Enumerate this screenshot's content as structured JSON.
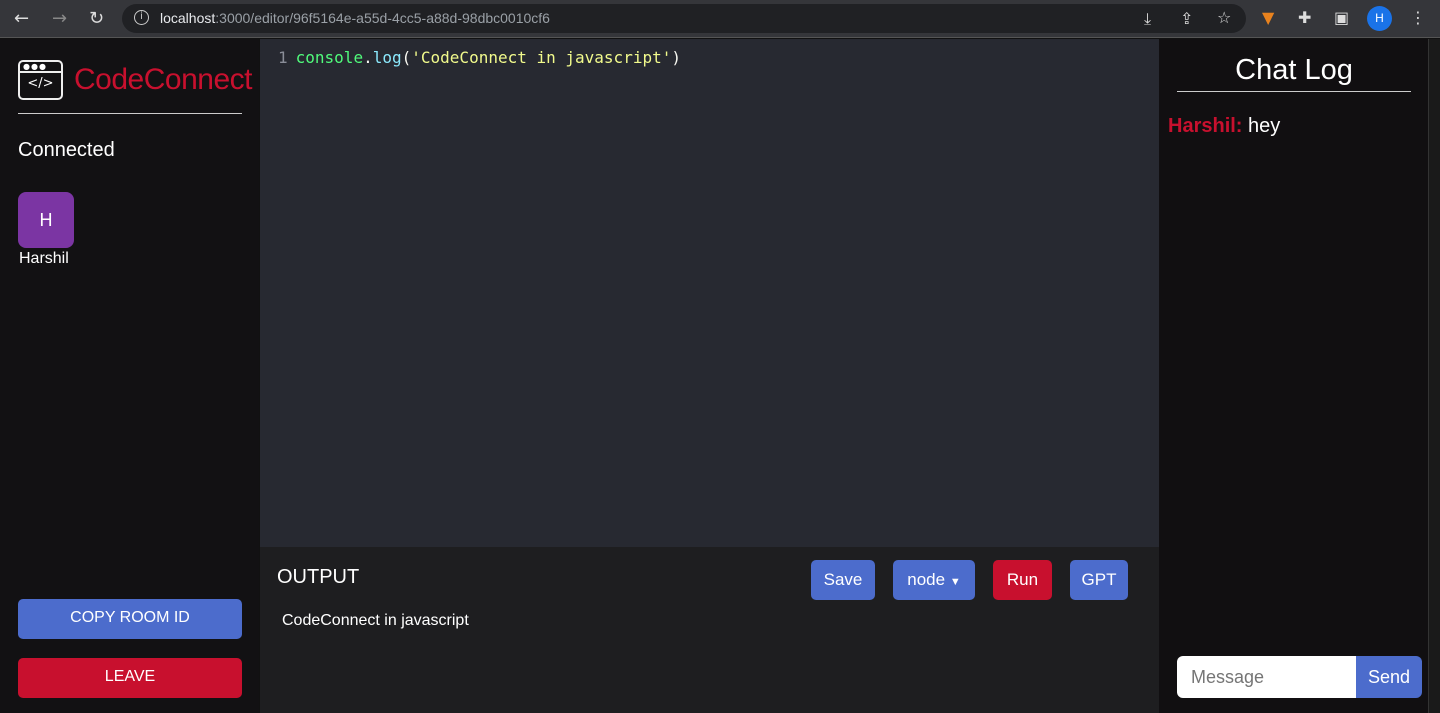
{
  "browser": {
    "url_host": "localhost",
    "url_rest": ":3000/editor/96f5164e-a55d-4cc5-a88d-98dbc0010cf6",
    "profile_initial": "H"
  },
  "sidebar": {
    "brand": "CodeConnect",
    "logo_glyph": "</>",
    "connected_label": "Connected",
    "users": [
      {
        "initial": "H",
        "name": "Harshil",
        "color": "#7b35a3"
      }
    ],
    "copy_room_label": "COPY ROOM ID",
    "leave_label": "LEAVE"
  },
  "editor": {
    "lines": [
      {
        "number": "1",
        "obj": "console",
        "dot": ".",
        "method": "log",
        "open": "(",
        "string": "'CodeConnect in javascript'",
        "close": ")"
      }
    ]
  },
  "output": {
    "title": "OUTPUT",
    "text": "CodeConnect in javascript",
    "save_label": "Save",
    "language": "node",
    "run_label": "Run",
    "gpt_label": "GPT"
  },
  "chat": {
    "title": "Chat Log",
    "messages": [
      {
        "user": "Harshil:",
        "text": "hey"
      }
    ],
    "placeholder": "Message",
    "send_label": "Send"
  },
  "colors": {
    "accent": "#4c6ccc",
    "danger": "#c8102e"
  }
}
